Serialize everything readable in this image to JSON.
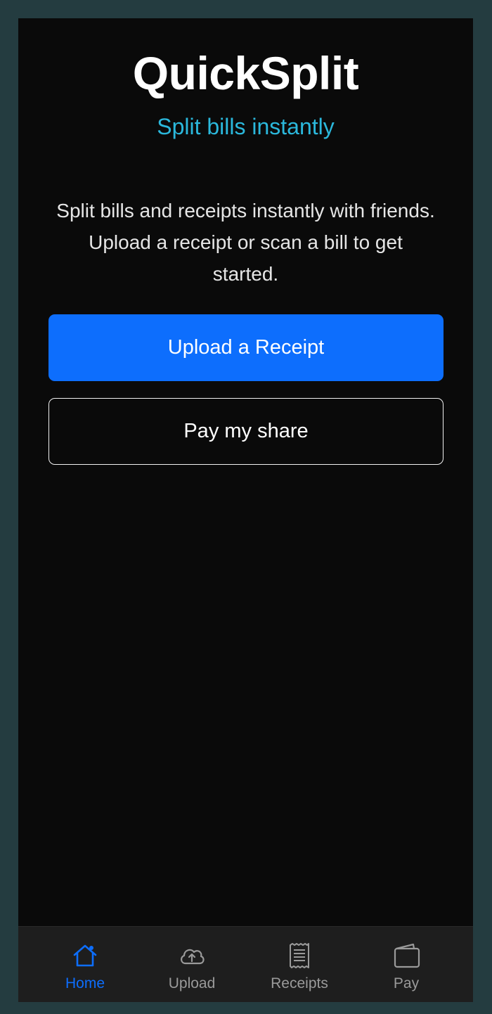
{
  "app": {
    "title": "QuickSplit",
    "subtitle": "Split bills instantly",
    "intro": "Split bills and receipts instantly with friends. Upload a receipt or scan a bill to get started."
  },
  "actions": {
    "upload_label": "Upload a Receipt",
    "pay_label": "Pay my share"
  },
  "tabbar": {
    "active": "Home",
    "items": [
      {
        "label": "Home",
        "icon": "home-icon"
      },
      {
        "label": "Upload",
        "icon": "cloud-upload-icon"
      },
      {
        "label": "Receipts",
        "icon": "receipt-icon"
      },
      {
        "label": "Pay",
        "icon": "wallet-icon"
      }
    ]
  },
  "colors": {
    "accent": "#0d6efd",
    "subtitle": "#2bb8dc",
    "background": "#0a0a0a",
    "tabbar_background": "#1e1e1e",
    "inactive_tab": "#9a9a9a"
  }
}
